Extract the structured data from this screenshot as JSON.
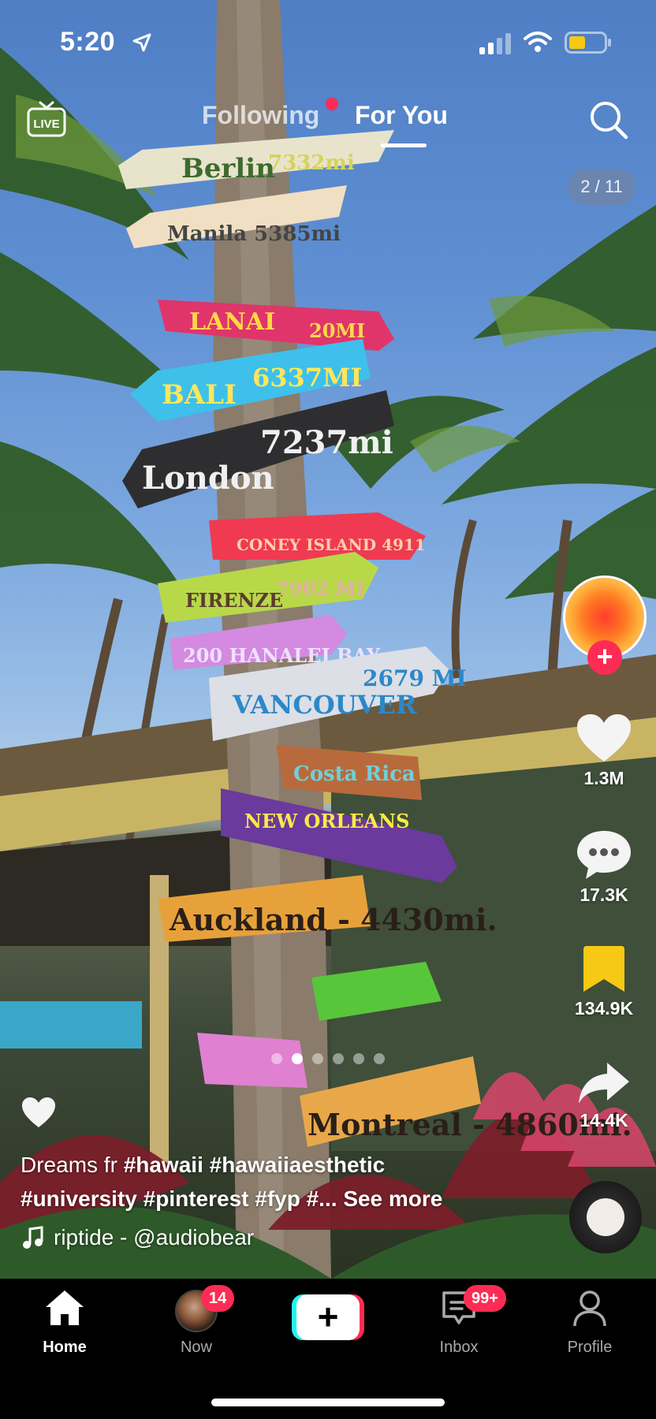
{
  "status_bar": {
    "time": "5:20"
  },
  "top_nav": {
    "live_label": "LIVE",
    "tabs": [
      {
        "label": "Following",
        "has_dot": true
      },
      {
        "label": "For You",
        "active": true
      }
    ]
  },
  "photo_counter": "2 / 11",
  "signposts": [
    "Berlin 7332mi",
    "Manila 5385mi",
    "LANAI 20MI",
    "BALI 6337MI",
    "London 7237mi",
    "CONEY ISLAND 4911",
    "FIRENZE 7902 MI",
    "200 HANALEI BAY",
    "VANCOUVER 2679 MI",
    "NEW ORLEANS",
    "Auckland - 4430mi.",
    "Montreal - 4860mi."
  ],
  "rail": {
    "likes": "1.3M",
    "comments": "17.3K",
    "saves": "134.9K",
    "shares": "14.4K"
  },
  "caption": {
    "prefix": "Dreams fr",
    "tags_line1": [
      "#hawaii",
      "#hawaiiaesthetic"
    ],
    "tags_line2": [
      "#university",
      "#pinterest",
      "#fyp",
      "#..."
    ],
    "see_more": "See more"
  },
  "sound": "riptide - @audiobear",
  "carousel": {
    "count": 6,
    "active_index": 1
  },
  "tab_bar": {
    "home": "Home",
    "now": "Now",
    "now_badge": "14",
    "inbox": "Inbox",
    "inbox_badge": "99+",
    "profile": "Profile",
    "create_symbol": "+"
  },
  "colors": {
    "accent_red": "#fe2c55",
    "accent_cyan": "#25f4ee",
    "save_yellow": "#f7c914"
  }
}
